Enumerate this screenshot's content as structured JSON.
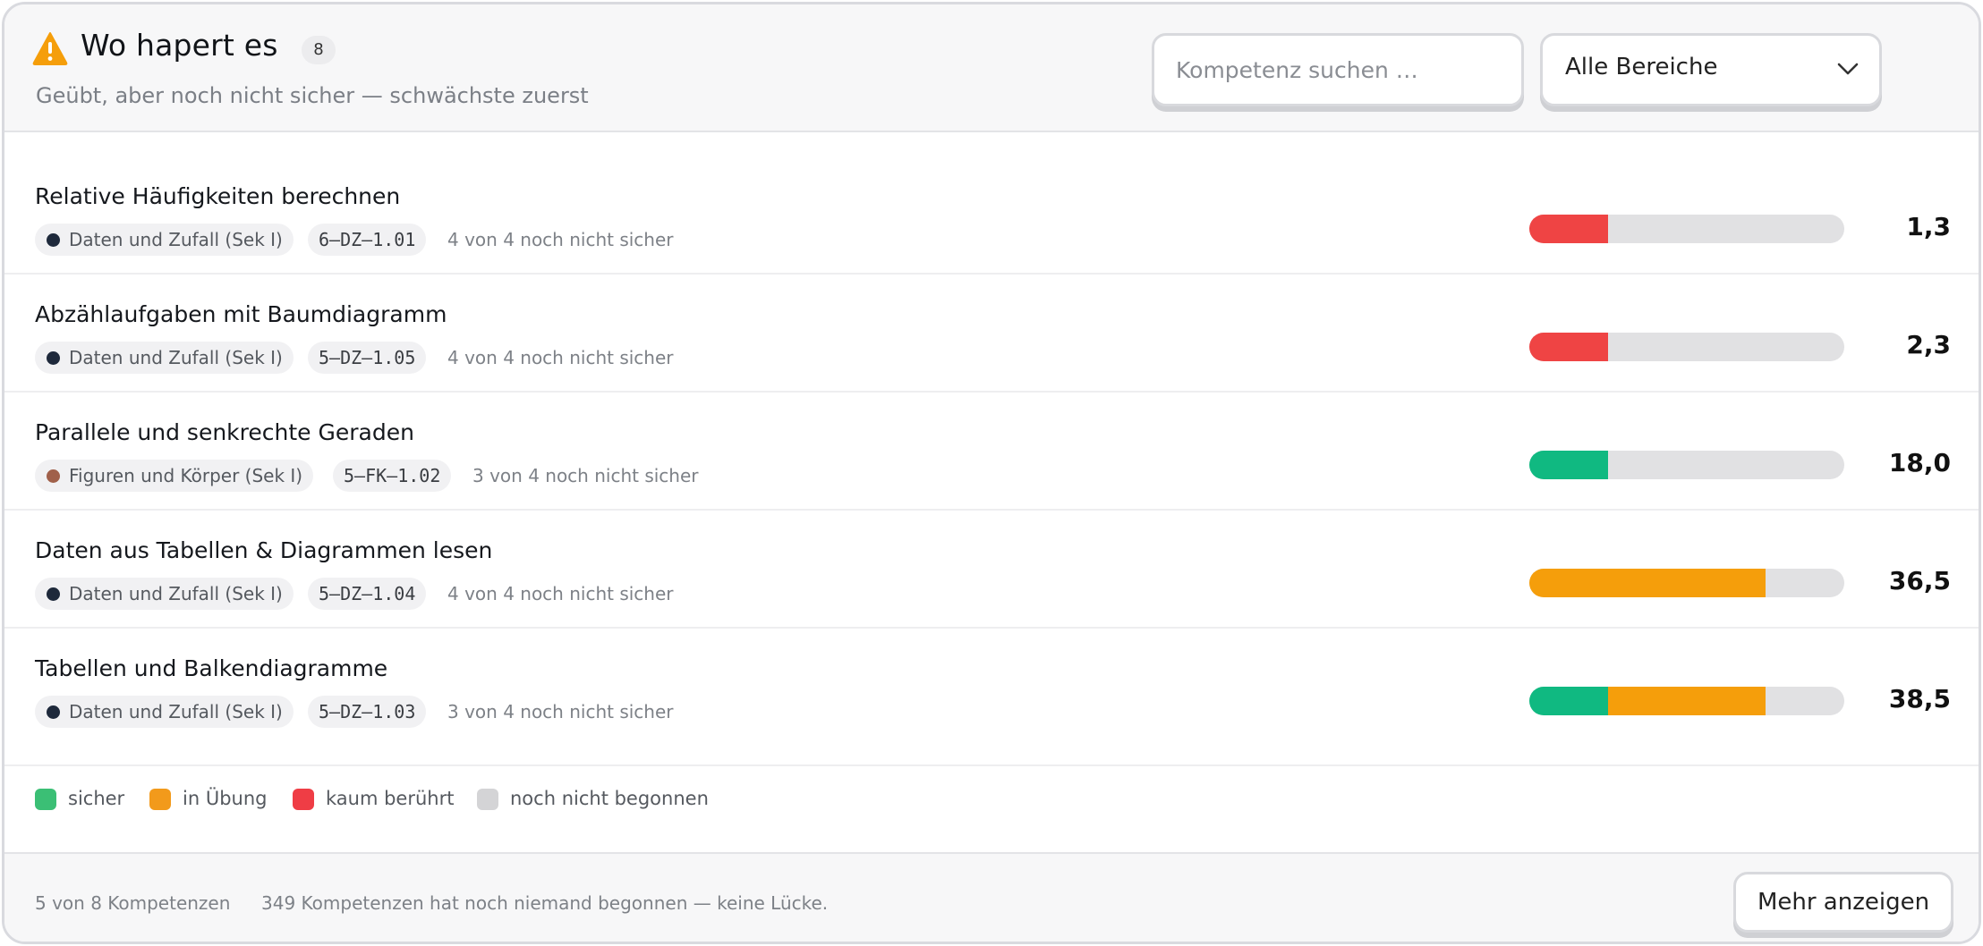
{
  "header": {
    "title": "Wo hapert es",
    "count": "8",
    "subtitle": "Geübt, aber noch nicht sicher — schwächste zuerst",
    "search_placeholder": "Kompetenz suchen …",
    "filter_value": "Alle Bereiche"
  },
  "colors": {
    "sicher": "#10b981",
    "in_uebung": "#f59e0b",
    "kaum": "#ef4444",
    "offen": "#e1e1e3",
    "dz_dot": "#1e293b",
    "fk_dot": "#a0604a"
  },
  "rows": [
    {
      "title": "Relative Häufigkeiten berechnen",
      "area": "Daten und Zufall (Sek I)",
      "area_dot": "#1e293b",
      "code": "6–DZ–1.01",
      "note": "4 von 4 noch nicht sicher",
      "score": "1,3",
      "segments": [
        {
          "status": "kaum",
          "fraction": 0.25
        }
      ]
    },
    {
      "title": "Abzählaufgaben mit Baumdiagramm",
      "area": "Daten und Zufall (Sek I)",
      "area_dot": "#1e293b",
      "code": "5–DZ–1.05",
      "note": "4 von 4 noch nicht sicher",
      "score": "2,3",
      "segments": [
        {
          "status": "kaum",
          "fraction": 0.25
        }
      ]
    },
    {
      "title": "Parallele und senkrechte Geraden",
      "area": "Figuren und Körper (Sek I)",
      "area_dot": "#a0604a",
      "code": "5–FK–1.02",
      "note": "3 von 4 noch nicht sicher",
      "score": "18,0",
      "segments": [
        {
          "status": "sicher",
          "fraction": 0.25
        }
      ]
    },
    {
      "title": "Daten aus Tabellen & Diagrammen lesen",
      "area": "Daten und Zufall (Sek I)",
      "area_dot": "#1e293b",
      "code": "5–DZ–1.04",
      "note": "4 von 4 noch nicht sicher",
      "score": "36,5",
      "segments": [
        {
          "status": "in_uebung",
          "fraction": 0.75
        }
      ]
    },
    {
      "title": "Tabellen und Balkendiagramme",
      "area": "Daten und Zufall (Sek I)",
      "area_dot": "#1e293b",
      "code": "5–DZ–1.03",
      "note": "3 von 4 noch nicht sicher",
      "score": "38,5",
      "segments": [
        {
          "status": "sicher",
          "fraction": 0.25
        },
        {
          "status": "in_uebung",
          "fraction": 0.5
        }
      ]
    }
  ],
  "legend": [
    {
      "label": "sicher",
      "color": "#3bbf75"
    },
    {
      "label": "in Übung",
      "color": "#f29a1b"
    },
    {
      "label": "kaum berührt",
      "color": "#ef3d45"
    },
    {
      "label": "noch nicht begonnen",
      "color": "#d4d4d6"
    }
  ],
  "footer": {
    "count_text": "5 von 8 Kompetenzen",
    "info_text": "349 Kompetenzen hat noch niemand begonnen — keine Lücke.",
    "more_label": "Mehr anzeigen"
  }
}
